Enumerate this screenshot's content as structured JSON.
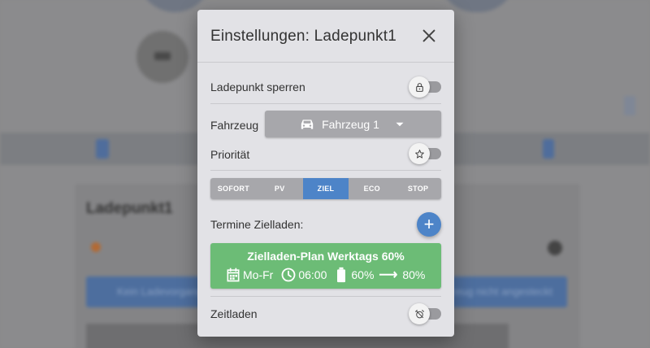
{
  "background": {
    "card_title": "Ladepunkt1",
    "info_left": "Kein Ladevorgang",
    "info_right": "Fahrzeug nicht angesteckt"
  },
  "dialog": {
    "title": "Einstellungen:  Ladepunkt1",
    "lock_label": "Ladepunkt sperren",
    "lock_on": false,
    "vehicle_label": "Fahrzeug",
    "vehicle_selected": "Fahrzeug 1",
    "priority_label": "Priorität",
    "priority_on": false,
    "modes": [
      "SOFORT",
      "PV",
      "ZIEL",
      "ECO",
      "STOP"
    ],
    "active_mode": "ZIEL",
    "schedule_label": "Termine Zielladen:",
    "plan": {
      "title": "Zielladen-Plan Werktags 60%",
      "days": "Mo-Fr",
      "time": "06:00",
      "soc_from": "60%",
      "arrow": "⟶",
      "soc_to": "80%"
    },
    "timecharge_label": "Zeitladen",
    "timecharge_on": false
  },
  "colors": {
    "accent": "#4d84c8",
    "plan_green": "#6cbc76",
    "dialog_bg": "#e2e2e6"
  }
}
